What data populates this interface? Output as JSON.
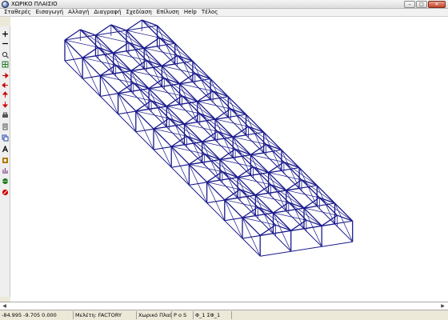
{
  "window": {
    "title": "ΧΩΡΙΚΟ ΠΛΑΙΣΙΟ",
    "minimize": "–",
    "maximize": "□",
    "close": "✕"
  },
  "menu": [
    "Σταθερές",
    "Εισαγωγή",
    "Αλλαγή",
    "Διαγραφή",
    "Σχεδίαση",
    "Επίλυση",
    "Help",
    "Τέλος"
  ],
  "toolbar": [
    {
      "name": "plus-icon",
      "color": "#000000"
    },
    {
      "name": "minus-icon",
      "color": "#000000"
    },
    {
      "name": "zoom-icon",
      "color": "#3a3a3a"
    },
    {
      "name": "grid-icon",
      "color": "#2a7a2a"
    },
    {
      "name": "arrow-right-icon",
      "color": "#cc0000"
    },
    {
      "name": "arrow-left-icon",
      "color": "#cc0000"
    },
    {
      "name": "arrow-up-icon",
      "color": "#cc0000"
    },
    {
      "name": "arrow-down-icon",
      "color": "#cc0000"
    },
    {
      "name": "print-icon",
      "color": "#555555"
    },
    {
      "name": "page-icon",
      "color": "#555555"
    },
    {
      "name": "copy-icon",
      "color": "#2244aa"
    },
    {
      "name": "text-a-icon",
      "color": "#000000"
    },
    {
      "name": "palette-icon",
      "color": "#b07a00"
    },
    {
      "name": "chart-icon",
      "color": "#884488"
    },
    {
      "name": "globe-icon",
      "color": "#1a7a1a"
    },
    {
      "name": "stop-icon",
      "color": "#cc0000"
    }
  ],
  "statusbar": {
    "coords": "-84.995 -9.705 0.000",
    "project": "Μελέτη: FACTORY",
    "mode": "Χωρικό Πλαίσιο",
    "units": "P o S",
    "phi": "Φ_1  ΣΦ_1"
  },
  "model": {
    "stroke_color": "#1a1a8c",
    "bays_long": 11,
    "bays_wide": 3
  }
}
